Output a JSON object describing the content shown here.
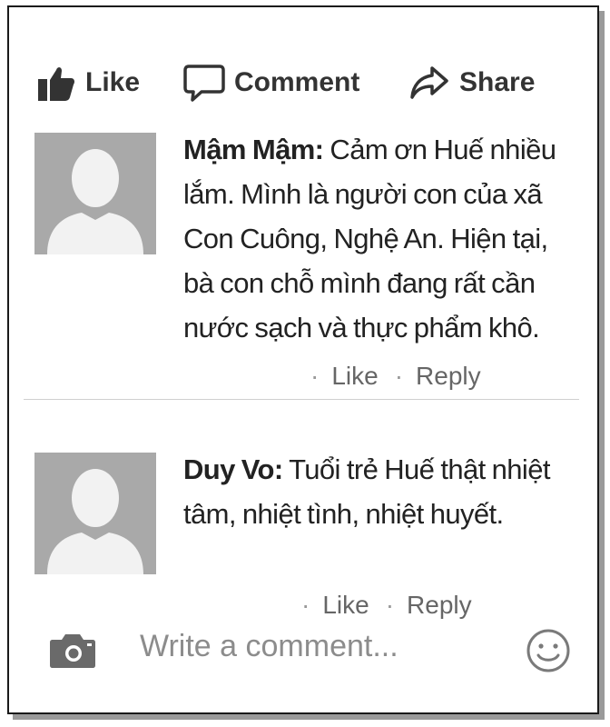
{
  "actions": {
    "like_label": "Like",
    "comment_label": "Comment",
    "share_label": "Share",
    "like_icon": "thumbs-up-icon",
    "comment_icon": "speech-bubble-icon",
    "share_icon": "share-arrow-icon"
  },
  "comments": [
    {
      "author": "Mậm Mậm:",
      "text": " Cảm ơn Huế nhiều lắm. Mình là người con của xã Con Cuông, Nghệ An. Hiện tại, bà con chỗ mình đang rất cần nước sạch và thực phẩm khô.",
      "like_label": "Like",
      "reply_label": "Reply",
      "separator": "·"
    },
    {
      "author": "Duy Vo:",
      "text": " Tuổi trẻ Huế thật nhiệt tâm, nhiệt tình, nhiệt huyết.",
      "like_label": "Like",
      "reply_label": "Reply",
      "separator": "·"
    }
  ],
  "composer": {
    "placeholder": "Write a comment...",
    "camera_icon": "camera-icon",
    "emoji_icon": "smiley-icon"
  },
  "colors": {
    "text": "#222222",
    "meta": "#666666",
    "placeholder": "#8c8c8c",
    "avatar_bg": "#a9a9a9",
    "icon": "#333333"
  }
}
